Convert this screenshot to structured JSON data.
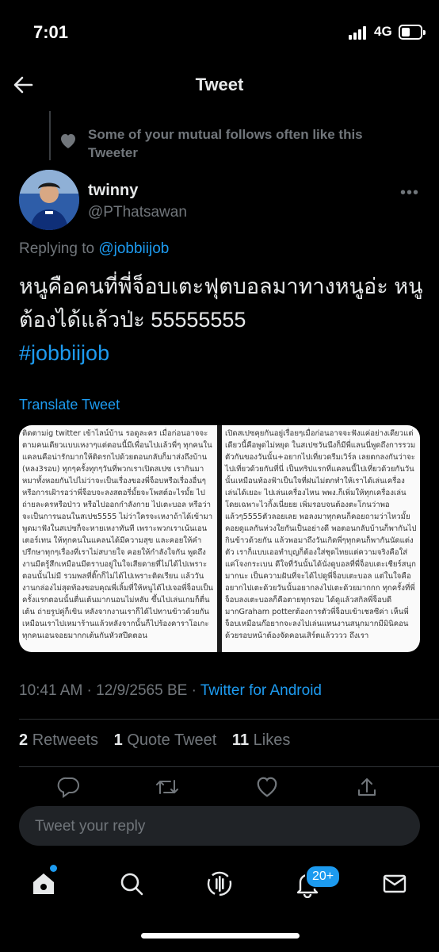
{
  "status_bar": {
    "time": "7:01",
    "network": "4G"
  },
  "header": {
    "title": "Tweet"
  },
  "social_context": {
    "text": "Some of your mutual follows often like this Tweeter"
  },
  "author": {
    "name": "twinny",
    "handle": "@PThatsawan"
  },
  "tweet": {
    "replying_prefix": "Replying to ",
    "replying_to": "@jobbiijob",
    "text": "หนูคือคนที่พี่จ็อบเตะฟุตบอลมาทางหนูอ่ะ หนูต้องได้แล้วป่ะ 55555555",
    "hashtag": "#jobbiijob",
    "translate_label": "Translate Tweet",
    "timestamp": "10:41 AM · 12/9/2565 BE · ",
    "source": "Twitter for Android"
  },
  "media": {
    "left_text": "ติดตามig twitter เข้าไลน์บ้าน รอดูละคร เมื่อก่อนอาจจะตามคนเดียวแบบเหงาๆแต่ตอนนี้มีเพื่อนไปแล้วพี่ๆ ทุกคนในแคลนคือน่ารักมากให้ติดรกไปด้วยตอนกลับก็มาส่งถึงบ้าน (หลง3รอบ) ทุกๆครั้งทุกๆวันที่พวกเราเปิดสเปซ เรากินมาหมาทั้งหอยกันไปไม่ว่าจะเป็นเรื่องของพี่จ็อบหรือเรื่องอื่นๆ หรือการเฝ้ารอว่าพี่จ็อบจะลงสตอรี่มั้ยจะโพสต์อะไรมั้ย ไปถ่ายละครหรือป่าว หรือไปออกกำลังกาย ไปเตะบอล หรือว่าจะเป็นการนอนในสเปซ5555 ไม่ว่าใครจะเหงาถ้าได้เข้ามาพูดมาฟังในสเปซก็จะหายเหงาทันที เพราะพวกเราเน้นเอนเตอร์เทน ให้ทุกคนในแคลนได้มีความสุข และคอยให้คำปรึกษาทุกๆเรื่องที่เราไม่สบายใจ คอยให้กำลังใจกัน พูดถึงงานมีตรู้สึกเหมือนมีตราบอยู่ในใจเสียดายที่ไม่ได้ไปเพราะตอนนั้นไม่มี รวมพลที่ติ๊กก็ไม่ได้ไปเพราะติดเรียน แล้ววันงานกล่องไม่สุดท้องขอบคุณพี่เลิ้มที่ให้หนูได้ไปเจอพี่จ็อบเป็นครั้งแรกตอนนั้นตื่นเต้นมากนอนไม่หลับ ขึ้นไปเล่นเกมก็ตื่นเต้น ถ่ายรูปคู่ก็เขิน หลังจากงานเราก็ได้ไปทานข้าวด้วยกันเหมือนเราไปเหมาร้านแล้วหลังจากนั้นก็ไปร้องคาราโอเกะทุกคนเอนจอยมากกเต้นกันหัวสปีดตอน",
    "right_text": "เปิดสเปซคุยกันอยู่เรื่อยๆเมื่อก่อนอาจจะฟังแค่อย่างเดียวแต่เดียวนี้คือพูดไม่หยุด ในสเปซวันนึงก็มีพี่แลนนี่พูดถึงการรวมตัวกันของวันนั้น+อยากไปเที่ยวดรีมเวิร์ล เลยตกลงกันว่าจะไปเที่ยวด้วยกันที่นี่ เป็นทริปแรกที่แคลนนี้ไปเที่ยวด้วยกันวันนั้นเหมือนท้องฟ้าเป็นใจที่ฝนไม่ตกทำให้เราได้เล่นเครื่องเล่นได้เยอะ ไปเล่นเครื่องไหน พพง.ก็เพิ่มให้ทุกเครื่องเล่น โดยเฉพาะไวกิ้งเนี่ยยย เพิ่มรอบจนต้องตะโกนว่าพอแล้วๆ5555ตัวลอยเลย พอลงมาทุกคนก็คอยถามว่าไหวมั้ยคอยดูแลกันห่วงใยกันเป็นอย่างดี พอตอนกลับบ้านก็พากันไปกินข้าวด้วยกัน แล้วพอมาถึงวันเกิดพี่ๆทุกคนก็พากันนัดแต่งตัว เราก็แบบเออทำบุญก็ต้องใส่ชุดไทยแต่ความจริงคือใส่แค่โจงกระเบน ดีใจที่วันนั้นได้นั่งดูบอลที่พี่จ็อบเตะเชียร์สนุกมากนะ เป็นความฝันที่จะได้ไปดูพี่จ็อบเตะบอล แต่ในใจคืออยากไปเตะด้วยวันนั้นอยากลงไปเตะด้วยมากกก ทุกครั้งที่พี่จ็อบลงเตะบอลก็คือตายทุกรอบ ได้ดูแล้วสกิลพี่จ็อบดีมากGraham potterต้องการตัวพี่จ็อบเข้าเชลซีค่า เห็นพี่จ็อบเหมือนก๊อยากจะลงไปเล่นแทนงานสนุกมากมีมินิคอนด้วยรอบหน้าต้องจัดคอนเสิร์ตแล้วววว ถึงเรา"
  },
  "stats": {
    "retweets_count": "2",
    "retweets_label": "Retweets",
    "quotes_count": "1",
    "quotes_label": "Quote Tweet",
    "likes_count": "11",
    "likes_label": "Likes"
  },
  "composer": {
    "placeholder": "Tweet your reply"
  },
  "tabbar": {
    "notifications_badge": "20+"
  },
  "colors": {
    "accent": "#1d9bf0",
    "background": "#000000",
    "muted": "#71767b"
  },
  "icons": [
    "back-arrow-icon",
    "heart-icon",
    "more-icon",
    "reply-icon",
    "retweet-icon",
    "like-icon",
    "share-icon",
    "home-icon",
    "search-icon",
    "spaces-icon",
    "bell-icon",
    "mail-icon"
  ]
}
